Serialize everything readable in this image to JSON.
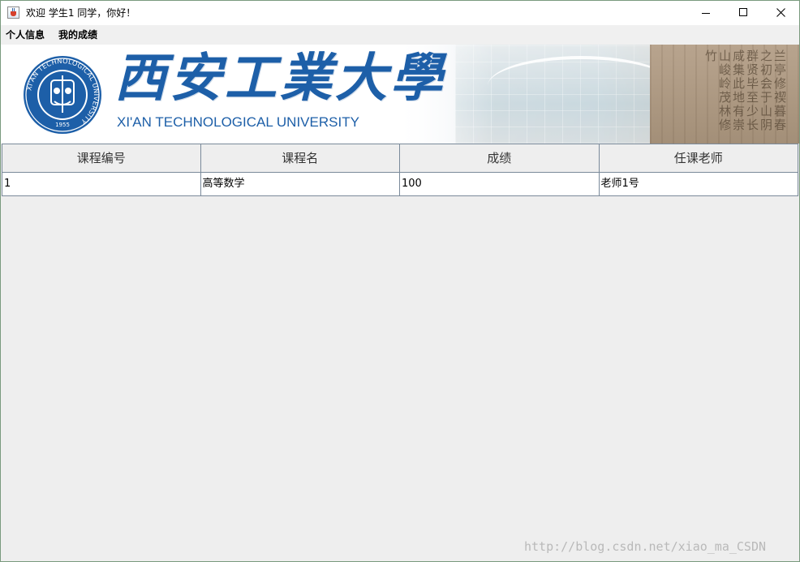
{
  "window": {
    "title": "欢迎 学生1 同学，你好！",
    "icon": "java-cup-icon",
    "controls": {
      "minimize": "minimize-icon",
      "maximize": "maximize-icon",
      "close": "close-icon"
    }
  },
  "menu": {
    "items": [
      {
        "label": "个人信息"
      },
      {
        "label": "我的成绩"
      }
    ]
  },
  "banner": {
    "title_cn": "西安工業大學",
    "title_en": "XI'AN TECHNOLOGICAL UNIVERSITY",
    "seal": {
      "ring_text": "XI'AN TECHNOLOGICAL UNIVERSITY",
      "year": "1955"
    },
    "brand_color": "#1d5fa8"
  },
  "table": {
    "columns": [
      "课程编号",
      "课程名",
      "成绩",
      "任课老师"
    ],
    "rows": [
      [
        "1",
        "高等数学",
        "100",
        "老师1号"
      ]
    ]
  },
  "watermark": "http://blog.csdn.net/xiao_ma_CSDN"
}
